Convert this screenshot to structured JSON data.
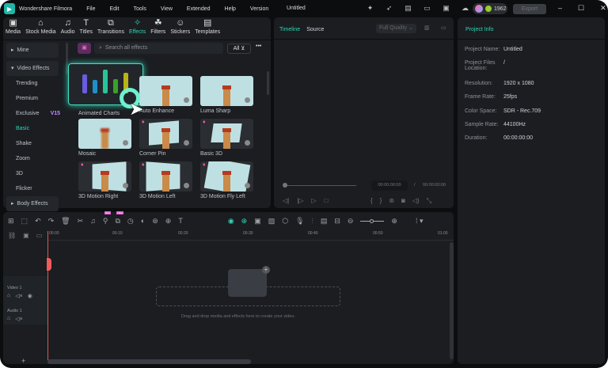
{
  "app": {
    "name": "Wondershare Filmora",
    "title": "Untitled",
    "menu": [
      "File",
      "Edit",
      "Tools",
      "View",
      "Extended",
      "Help",
      "Version"
    ],
    "credits": "1962",
    "export_label": "Export"
  },
  "nav": [
    {
      "label": "Media",
      "icon": "▣"
    },
    {
      "label": "Stock Media",
      "icon": "⌂"
    },
    {
      "label": "Audio",
      "icon": "♫"
    },
    {
      "label": "Titles",
      "icon": "T"
    },
    {
      "label": "Transitions",
      "icon": "⧉"
    },
    {
      "label": "Effects",
      "icon": "✧"
    },
    {
      "label": "Filters",
      "icon": "☘"
    },
    {
      "label": "Stickers",
      "icon": "☺"
    },
    {
      "label": "Templates",
      "icon": "▤"
    }
  ],
  "sidebar": {
    "mine": "Mine",
    "video_effects": "Video Effects",
    "items": [
      "Trending",
      "Premium",
      "Exclusive",
      "Basic",
      "Shake",
      "Zoom",
      "3D",
      "Flicker"
    ],
    "exclusive_badge": "V15",
    "body_effects": "Body Effects"
  },
  "search": {
    "placeholder": "Search all effects",
    "filter": "All"
  },
  "effects": [
    "Animated Charts",
    "Auto Enhance",
    "Luma Sharp",
    "Mosaic",
    "Corner Pin",
    "Basic 3D",
    "3D Motion Right",
    "3D Motion Left",
    "3D Motion Fly Left"
  ],
  "chart_colors": [
    "#6a5ce0",
    "#1e90c8",
    "#28c49a",
    "#3aa02a",
    "#b8b418"
  ],
  "preview": {
    "tab_timeline": "Timeline",
    "tab_source": "Source",
    "quality": "Full Quality",
    "current_time": "00:00:00:00",
    "separator": "/",
    "total_time": "00:00:00:00"
  },
  "project_info": {
    "title": "Project Info",
    "rows": [
      {
        "k": "Project Name:",
        "v": "Untitled"
      },
      {
        "k": "Project Files Location:",
        "v": "/"
      },
      {
        "k": "Resolution:",
        "v": "1920 x 1080"
      },
      {
        "k": "Frame Rate:",
        "v": "25fps"
      },
      {
        "k": "Color Space:",
        "v": "SDR - Rec.709"
      },
      {
        "k": "Sample Rate:",
        "v": "44100Hz"
      },
      {
        "k": "Duration:",
        "v": "00:00:00:00"
      }
    ]
  },
  "timeline": {
    "ruler": [
      "00:00",
      "00:10",
      "00:20",
      "00:30",
      "00:40",
      "00:50",
      "01:00"
    ],
    "video_track": "Video 1",
    "audio_track": "Audio 1",
    "drop_hint": "Drag and drop media and effects here to create your video.",
    "new_badge": "New"
  }
}
